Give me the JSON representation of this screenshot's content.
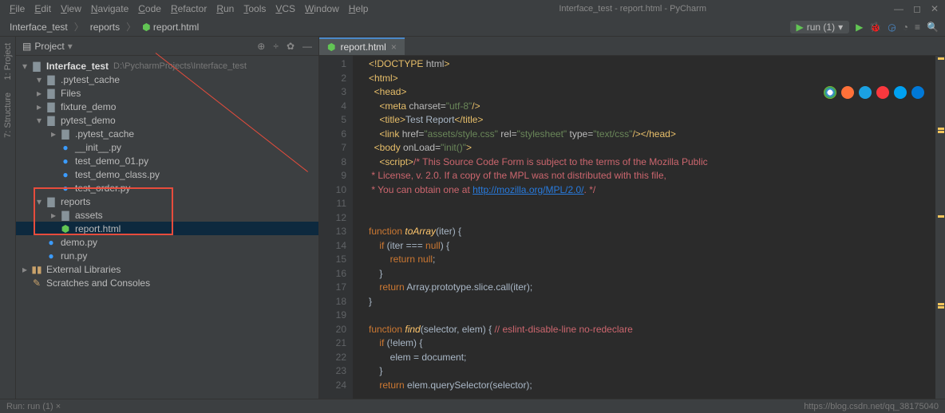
{
  "titlebar": {
    "menus": [
      "File",
      "Edit",
      "View",
      "Navigate",
      "Code",
      "Refactor",
      "Run",
      "Tools",
      "VCS",
      "Window",
      "Help"
    ],
    "title": "Interface_test - report.html - PyCharm"
  },
  "breadcrumb": [
    "Interface_test",
    "reports",
    "report.html"
  ],
  "run_config": "run (1)",
  "project_panel": {
    "title": "Project",
    "root_name": "Interface_test",
    "root_path": "D:\\PycharmProjects\\Interface_test",
    "tree": [
      {
        "depth": 1,
        "arrow": "▾",
        "icon": "folder",
        "name": ".pytest_cache"
      },
      {
        "depth": 1,
        "arrow": "▸",
        "icon": "folder",
        "name": "Files"
      },
      {
        "depth": 1,
        "arrow": "▸",
        "icon": "folder",
        "name": "fixture_demo"
      },
      {
        "depth": 1,
        "arrow": "▾",
        "icon": "folder",
        "name": "pytest_demo"
      },
      {
        "depth": 2,
        "arrow": "▸",
        "icon": "folder",
        "name": ".pytest_cache"
      },
      {
        "depth": 2,
        "arrow": "",
        "icon": "py",
        "name": "__init__.py"
      },
      {
        "depth": 2,
        "arrow": "",
        "icon": "py",
        "name": "test_demo_01.py"
      },
      {
        "depth": 2,
        "arrow": "",
        "icon": "py",
        "name": "test_demo_class.py"
      },
      {
        "depth": 2,
        "arrow": "",
        "icon": "py",
        "name": "test_order.py"
      },
      {
        "depth": 1,
        "arrow": "▾",
        "icon": "folder",
        "name": "reports"
      },
      {
        "depth": 2,
        "arrow": "▸",
        "icon": "folder",
        "name": "assets"
      },
      {
        "depth": 2,
        "arrow": "",
        "icon": "html",
        "name": "report.html",
        "selected": true
      },
      {
        "depth": 1,
        "arrow": "",
        "icon": "py",
        "name": "demo.py"
      },
      {
        "depth": 1,
        "arrow": "",
        "icon": "py",
        "name": "run.py"
      }
    ],
    "extra": [
      {
        "arrow": "▸",
        "icon": "lib",
        "name": "External Libraries"
      },
      {
        "arrow": "",
        "icon": "scratch",
        "name": "Scratches and Consoles"
      }
    ]
  },
  "editor": {
    "tab_label": "report.html",
    "lines": [
      {
        "n": 1,
        "html": "<span class='tag'>&lt;!DOCTYPE <span class='attr'>html</span>&gt;</span>"
      },
      {
        "n": 2,
        "html": "<span class='tag'>&lt;html&gt;</span>"
      },
      {
        "n": 3,
        "html": "  <span class='tag'>&lt;head&gt;</span>"
      },
      {
        "n": 4,
        "html": "    <span class='tag'>&lt;meta </span><span class='attr'>charset=</span><span class='str'>\"utf-8\"</span><span class='tag'>/&gt;</span>"
      },
      {
        "n": 5,
        "html": "    <span class='tag'>&lt;title&gt;</span>Test Report<span class='tag'>&lt;/title&gt;</span>"
      },
      {
        "n": 6,
        "html": "    <span class='tag'>&lt;link </span><span class='attr'>href=</span><span class='str'>\"assets/style.css\"</span> <span class='attr'>rel=</span><span class='str'>\"stylesheet\"</span> <span class='attr'>type=</span><span class='str'>\"text/css\"</span><span class='tag'>/&gt;&lt;/head&gt;</span>"
      },
      {
        "n": 7,
        "html": "  <span class='tag'>&lt;body </span><span class='attr'>onLoad=</span><span class='str'>\"init()\"</span><span class='tag'>&gt;</span>"
      },
      {
        "n": 8,
        "html": "    <span class='tag'>&lt;script&gt;</span><span class='comment'>/* This Source Code Form is subject to the terms of the Mozilla Public</span>"
      },
      {
        "n": 9,
        "html": "<span class='comment'> * License, v. 2.0. If a copy of the MPL was not distributed with this file,</span>"
      },
      {
        "n": 10,
        "html": "<span class='comment'> * You can obtain one at </span><span class='link'>http://mozilla.org/MPL/2.0/</span><span class='comment'>. */</span>"
      },
      {
        "n": 11,
        "html": ""
      },
      {
        "n": 12,
        "html": ""
      },
      {
        "n": 13,
        "html": "<span class='js-kw'>function</span> <span class='js-id'>toArray</span>(iter) {"
      },
      {
        "n": 14,
        "html": "    <span class='js-kw'>if</span> (iter === <span class='js-kw'>null</span>) {"
      },
      {
        "n": 15,
        "html": "        <span class='js-kw'>return null</span>;"
      },
      {
        "n": 16,
        "html": "    }"
      },
      {
        "n": 17,
        "html": "    <span class='js-kw'>return</span> Array.prototype.slice.call(iter);"
      },
      {
        "n": 18,
        "html": "}"
      },
      {
        "n": 19,
        "html": ""
      },
      {
        "n": 20,
        "html": "<span class='js-kw'>function</span> <span class='js-id'>find</span>(selector, elem) { <span class='comment'>// eslint-disable-line no-redeclare</span>"
      },
      {
        "n": 21,
        "html": "    <span class='js-kw'>if</span> (!elem) {"
      },
      {
        "n": 22,
        "html": "        elem = document;"
      },
      {
        "n": 23,
        "html": "    }"
      },
      {
        "n": 24,
        "html": "    <span class='js-kw'>return</span> elem.querySelector(selector);"
      }
    ]
  },
  "statusbar": {
    "left": "Run:    run (1) ×",
    "right": "https://blog.csdn.net/qq_38175040"
  },
  "sidetabs": [
    "1: Project",
    "7: Structure"
  ]
}
